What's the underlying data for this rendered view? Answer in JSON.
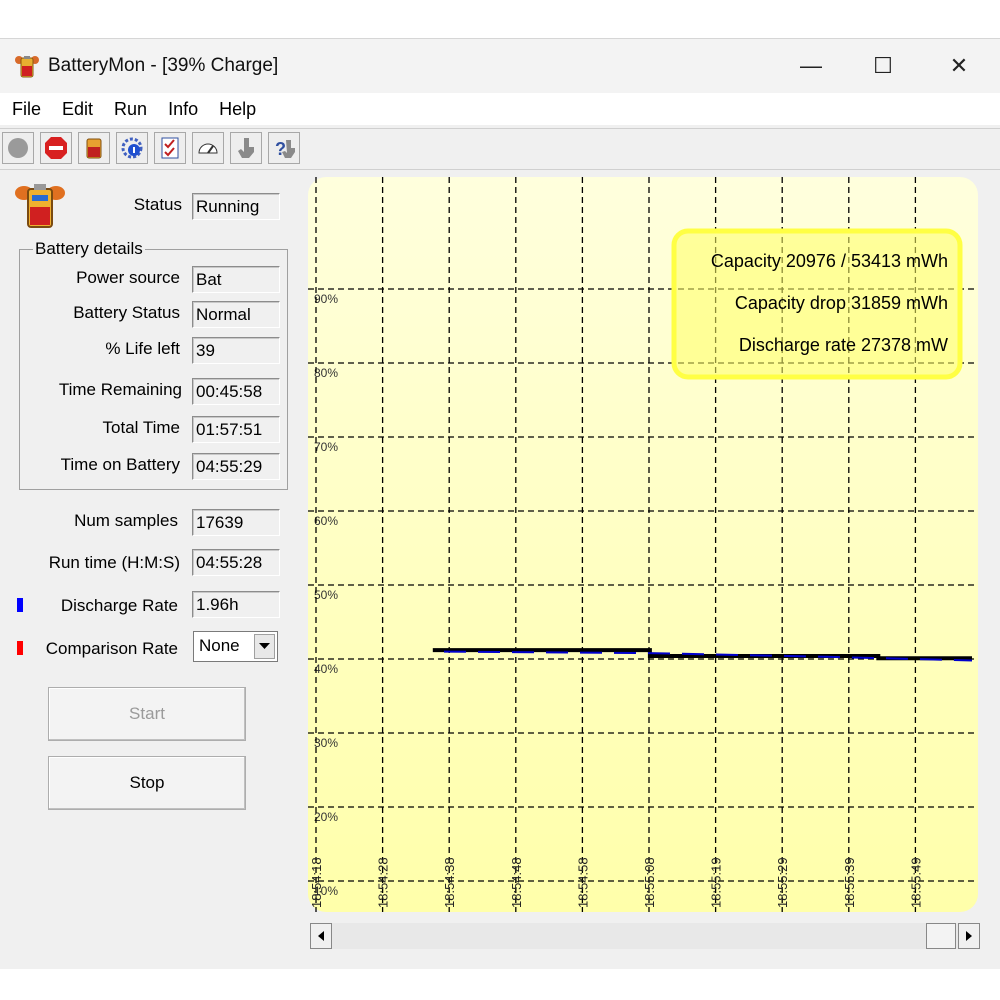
{
  "window": {
    "title": "BatteryMon - [39% Charge]"
  },
  "titlebar": {
    "minimize_glyph": "—",
    "maximize_glyph": "☐",
    "close_glyph": "✕"
  },
  "menu": [
    "File",
    "Edit",
    "Run",
    "Info",
    "Help"
  ],
  "toolbar": {
    "icons": [
      "record-icon",
      "stop-icon",
      "battery-icon",
      "settings-icon",
      "checklist-icon",
      "gauge-icon",
      "pointer-icon",
      "help-icon"
    ]
  },
  "status": {
    "label": "Status",
    "value": "Running"
  },
  "battery_details": {
    "title": "Battery details",
    "fields": [
      {
        "label": "Power source",
        "value": "Bat"
      },
      {
        "label": "Battery Status",
        "value": "Normal"
      },
      {
        "label": "% Life left",
        "value": "39"
      },
      {
        "label": "Time Remaining",
        "value": "00:45:58"
      },
      {
        "label": "Total Time",
        "value": "01:57:51"
      },
      {
        "label": "Time on Battery",
        "value": "04:55:29"
      }
    ]
  },
  "stats": [
    {
      "label": "Num samples",
      "value": "17639"
    },
    {
      "label": "Run time (H:M:S)",
      "value": "04:55:28"
    }
  ],
  "discharge": {
    "label": "Discharge Rate",
    "value": "1.96h",
    "color": "#0000ff"
  },
  "comparison": {
    "label": "Comparison Rate",
    "selected": "None",
    "color": "#ff0000"
  },
  "buttons": {
    "start": "Start",
    "stop": "Stop"
  },
  "chart_data": {
    "type": "line",
    "y_tick_labels": [
      "90%",
      "80%",
      "70%",
      "60%",
      "50%",
      "40%",
      "30%",
      "20%",
      "10%"
    ],
    "x_tick_labels": [
      "18:54:18",
      "18:54:28",
      "18:54:38",
      "18:54:48",
      "18:54:58",
      "18:55:08",
      "18:55:19",
      "18:55:29",
      "18:55:39",
      "18:55:49"
    ],
    "ylim": [
      10,
      100
    ],
    "grid": true,
    "background_color": "#ffffaa",
    "info_box": [
      "Capacity 20976 / 53413 mWh",
      "Capacity drop 31859 mWh",
      "Discharge rate 27378 mW"
    ],
    "series": [
      {
        "style": "solid",
        "color": "#000000",
        "points": [
          [
            18.3,
            41.2
          ],
          [
            51.2,
            41.2
          ],
          [
            51.2,
            40.4
          ],
          [
            85.8,
            40.4
          ],
          [
            85.8,
            40.1
          ],
          [
            100,
            40.1
          ]
        ]
      },
      {
        "style": "dashed",
        "color": "#0000cc",
        "points": [
          [
            20,
            41.0
          ],
          [
            51,
            40.8
          ],
          [
            78,
            40.3
          ],
          [
            100,
            39.8
          ]
        ]
      }
    ]
  }
}
